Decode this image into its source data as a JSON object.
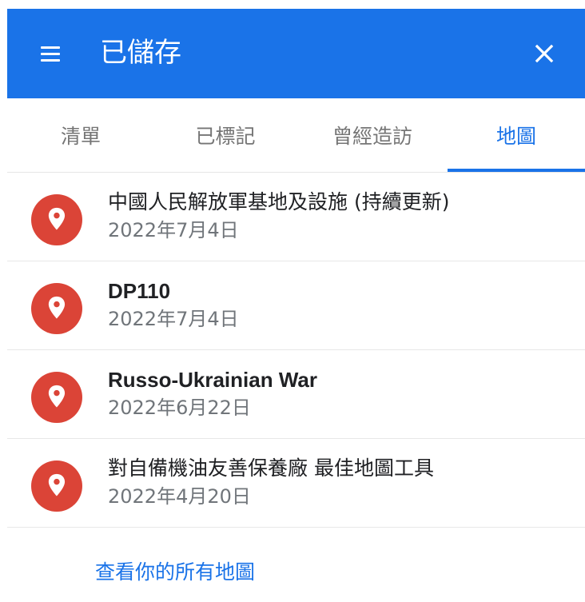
{
  "header": {
    "title": "已儲存",
    "menu_icon": "menu-icon",
    "close_icon": "close-icon"
  },
  "tabs": [
    {
      "label": "清單",
      "active": false
    },
    {
      "label": "已標記",
      "active": false
    },
    {
      "label": "曾經造訪",
      "active": false
    },
    {
      "label": "地圖",
      "active": true
    }
  ],
  "maps": [
    {
      "title": "中國人民解放軍基地及設施 (持續更新)",
      "date": "2022年7月4日",
      "icon": "map-pin-icon"
    },
    {
      "title": "DP110",
      "date": "2022年7月4日",
      "icon": "map-pin-icon"
    },
    {
      "title": "Russo-Ukrainian War",
      "date": "2022年6月22日",
      "icon": "map-pin-icon"
    },
    {
      "title": "對自備機油友善保養廠 最佳地圖工具",
      "date": "2022年4月20日",
      "icon": "map-pin-icon"
    }
  ],
  "footer": {
    "view_all_label": "查看你的所有地圖"
  },
  "colors": {
    "accent": "#1a73e8",
    "pin": "#db4437",
    "secondary_text": "#70757a"
  }
}
